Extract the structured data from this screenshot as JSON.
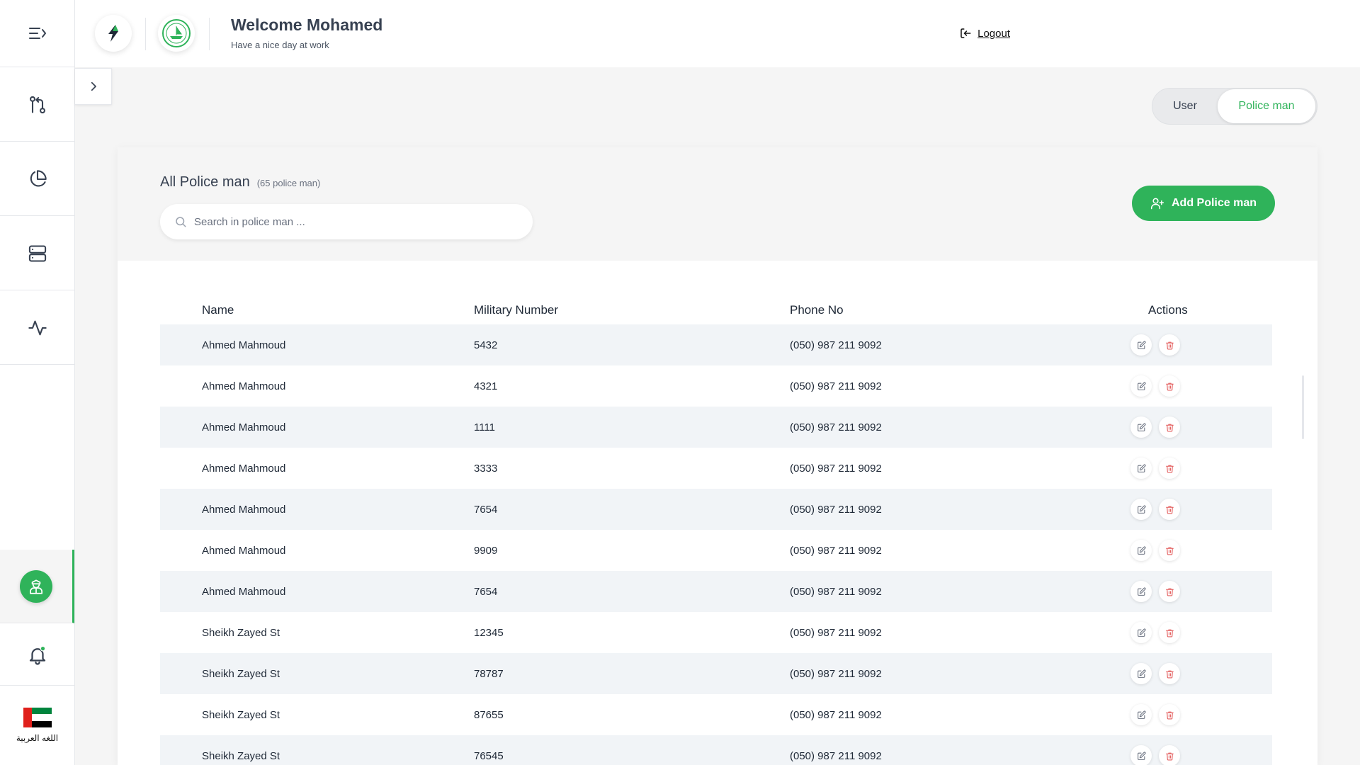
{
  "header": {
    "welcome_title": "Welcome Mohamed",
    "welcome_sub": "Have a nice day at work",
    "logout_label": "Logout"
  },
  "sidebar": {
    "items": [
      {
        "icon": "git-pull-request-icon"
      },
      {
        "icon": "pie-chart-icon"
      },
      {
        "icon": "server-icon"
      },
      {
        "icon": "activity-icon"
      },
      {
        "icon": "police-officer-icon",
        "active": true
      },
      {
        "icon": "bell-icon"
      }
    ],
    "language_label": "اللغه العربية"
  },
  "role_toggle": {
    "options": [
      "User",
      "Police man"
    ],
    "selected": "Police man"
  },
  "panel": {
    "title": "All Police man",
    "count": "(65 police man)",
    "search_placeholder": "Search in police man ...",
    "add_button": "Add Police man"
  },
  "table": {
    "columns": [
      "Name",
      "Military Number",
      "Phone No",
      "Actions"
    ],
    "rows": [
      {
        "name": "Ahmed Mahmoud",
        "military": "5432",
        "phone": "(050) 987 211 9092"
      },
      {
        "name": "Ahmed Mahmoud",
        "military": "4321",
        "phone": "(050) 987 211 9092"
      },
      {
        "name": "Ahmed Mahmoud",
        "military": "1111",
        "phone": "(050) 987 211 9092"
      },
      {
        "name": "Ahmed Mahmoud",
        "military": "3333",
        "phone": "(050) 987 211 9092"
      },
      {
        "name": "Ahmed Mahmoud",
        "military": "7654",
        "phone": "(050) 987 211 9092"
      },
      {
        "name": "Ahmed Mahmoud",
        "military": "9909",
        "phone": "(050) 987 211 9092"
      },
      {
        "name": "Ahmed Mahmoud",
        "military": "7654",
        "phone": "(050) 987 211 9092"
      },
      {
        "name": "Sheikh Zayed St",
        "military": "12345",
        "phone": "(050) 987 211 9092"
      },
      {
        "name": "Sheikh Zayed St",
        "military": "78787",
        "phone": "(050) 987 211 9092"
      },
      {
        "name": "Sheikh Zayed St",
        "military": "87655",
        "phone": "(050) 987 211 9092"
      },
      {
        "name": "Sheikh Zayed St",
        "military": "76545",
        "phone": "(050) 987 211 9092"
      }
    ]
  },
  "colors": {
    "accent": "#2fb35a",
    "delete": "#e35d5d"
  }
}
